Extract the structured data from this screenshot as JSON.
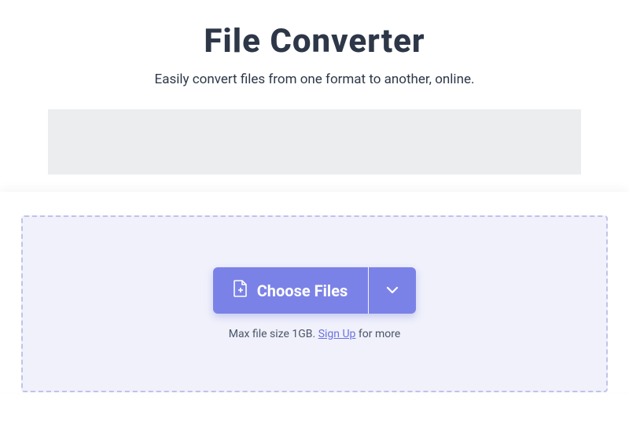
{
  "header": {
    "title": "File Converter",
    "subtitle": "Easily convert files from one format to another, online."
  },
  "upload": {
    "choose_files_label": "Choose Files",
    "hint_prefix": "Max file size 1GB. ",
    "signup_label": "Sign Up",
    "hint_suffix": " for more"
  },
  "colors": {
    "primary": "#7b82e7",
    "text_dark": "#2d3748",
    "dropzone_bg": "#f0f1fb",
    "dropzone_border": "#bfc3e8"
  }
}
